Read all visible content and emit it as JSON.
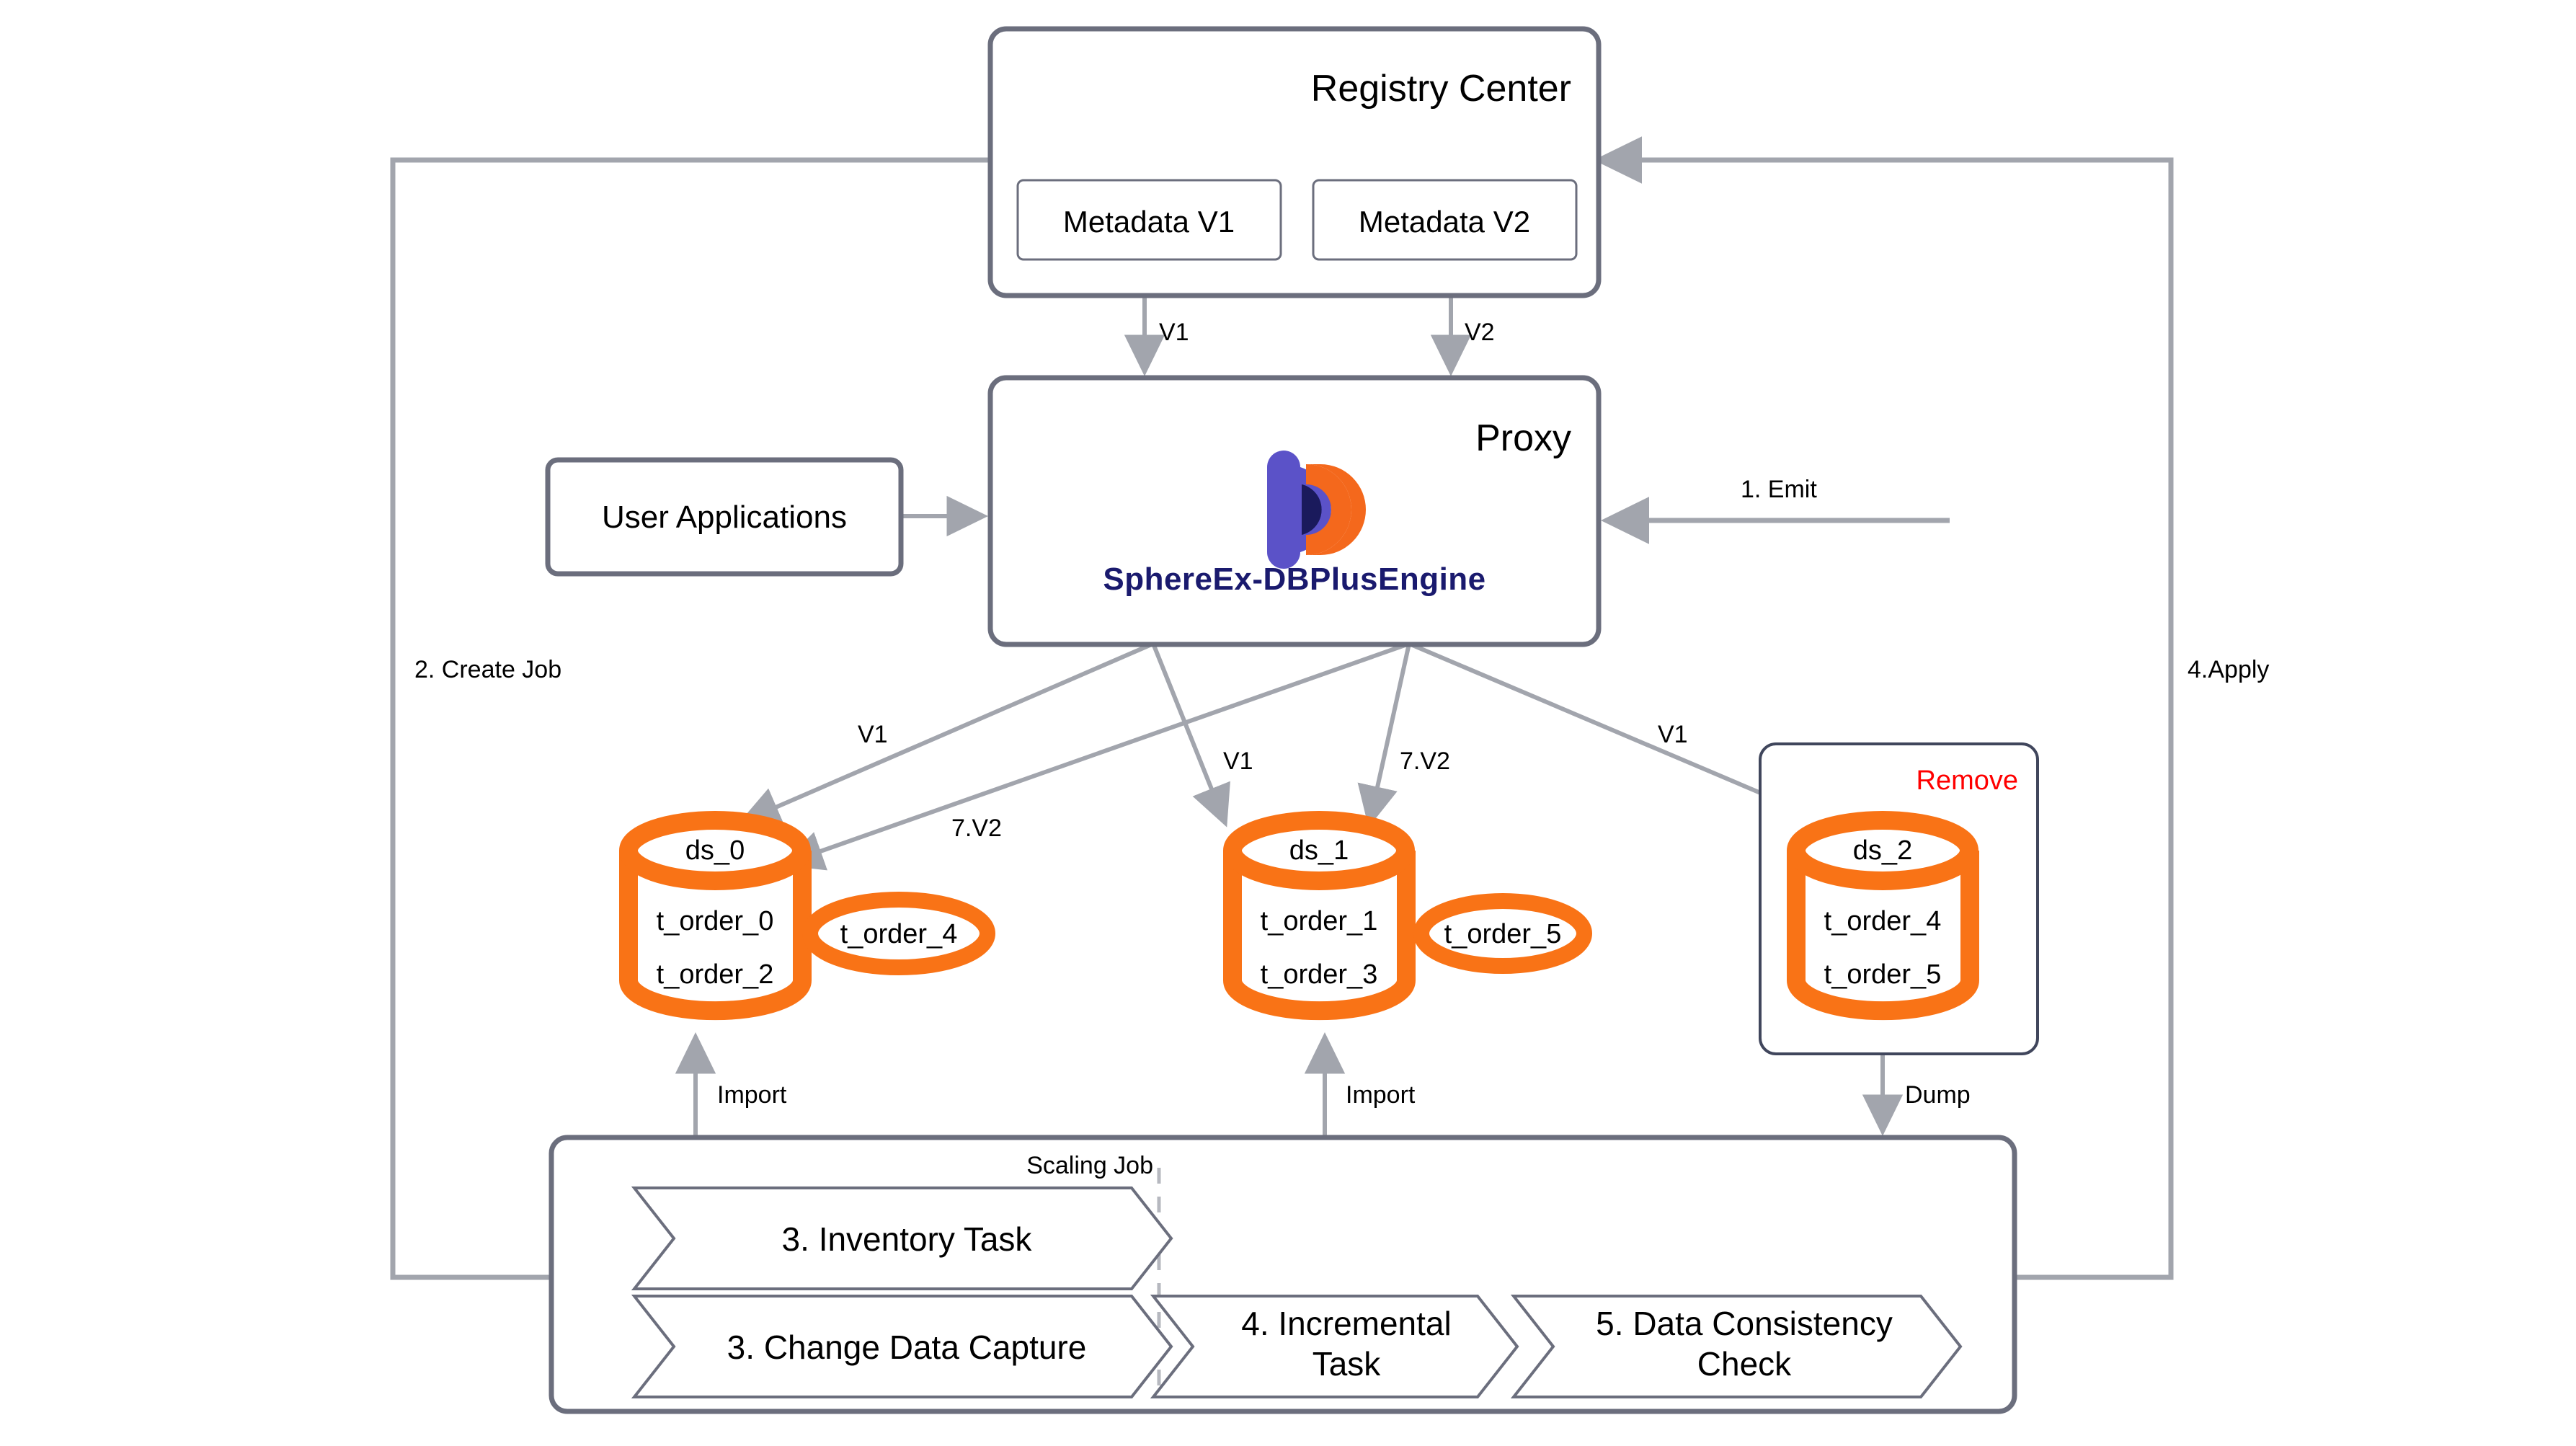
{
  "diagram": {
    "title_registry": "Registry Center",
    "title_proxy": "Proxy",
    "colors": {
      "accent_orange": "#f97316",
      "box_gray": "#6b6e7d",
      "connector_gray": "#a2a5ad",
      "remove_red": "#ff0000",
      "brand_navy": "#1a1a6e",
      "brand_purple": "#5b52c8"
    }
  },
  "registry_center": {
    "title": "Registry Center",
    "metadata": [
      {
        "label": "Metadata V1"
      },
      {
        "label": "Metadata V2"
      }
    ]
  },
  "proxy": {
    "title": "Proxy",
    "brand": "SphereEx-DBPlusEngine",
    "logo_name": "dbplusengine-logo"
  },
  "user_applications": {
    "label": "User Applications"
  },
  "datasources": [
    {
      "name": "ds_0",
      "tables": [
        "t_order_0",
        "t_order_2"
      ],
      "satellite": "t_order_4",
      "removed": false
    },
    {
      "name": "ds_1",
      "tables": [
        "t_order_1",
        "t_order_3"
      ],
      "satellite": "t_order_5",
      "removed": false
    },
    {
      "name": "ds_2",
      "tables": [
        "t_order_4",
        "t_order_5"
      ],
      "satellite": null,
      "removed": true,
      "remove_label": "Remove"
    }
  ],
  "scaling_job": {
    "title": "Scaling Job",
    "tasks": [
      {
        "label": "3. Inventory Task"
      },
      {
        "label": "3. Change Data Capture"
      },
      {
        "label_line1": "4. Incremental",
        "label_line2": "Task"
      },
      {
        "label_line1": "5. Data Consistency",
        "label_line2": "Check"
      }
    ]
  },
  "edge_labels": {
    "registry_to_proxy_v1": "V1",
    "registry_to_proxy_v2": "V2",
    "emit": "1. Emit",
    "create_job": "2. Create Job",
    "apply": "4.Apply",
    "proxy_ds0_v1": "V1",
    "proxy_ds0_v2": "7.V2",
    "proxy_ds1_v1": "V1",
    "proxy_ds1_v2": "7.V2",
    "proxy_ds2_v1": "V1",
    "import_ds0": "Import",
    "import_ds1": "Import",
    "dump_ds2": "Dump"
  }
}
